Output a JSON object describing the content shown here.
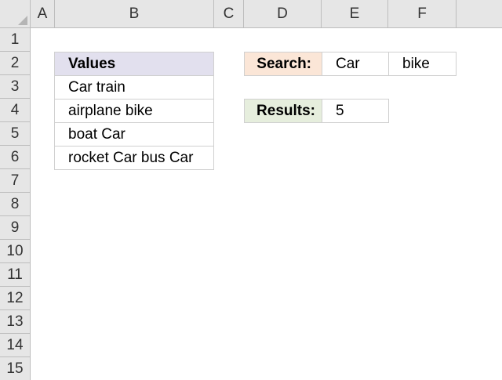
{
  "sheet": {
    "columns": [
      "A",
      "B",
      "C",
      "D",
      "E",
      "F"
    ],
    "rows": [
      "1",
      "2",
      "3",
      "4",
      "5",
      "6",
      "7",
      "8",
      "9",
      "10",
      "11",
      "12",
      "13",
      "14",
      "15"
    ]
  },
  "values_table": {
    "header": "Values",
    "items": [
      "Car train",
      "airplane bike",
      "boat Car",
      "rocket Car bus Car"
    ]
  },
  "search": {
    "label": "Search:",
    "term1": "Car",
    "term2": "bike"
  },
  "results": {
    "label": "Results:",
    "value": "5"
  },
  "colors": {
    "header_fill": "#e2e0ee",
    "search_fill": "#fbe6d7",
    "results_fill": "#e6eedd"
  }
}
